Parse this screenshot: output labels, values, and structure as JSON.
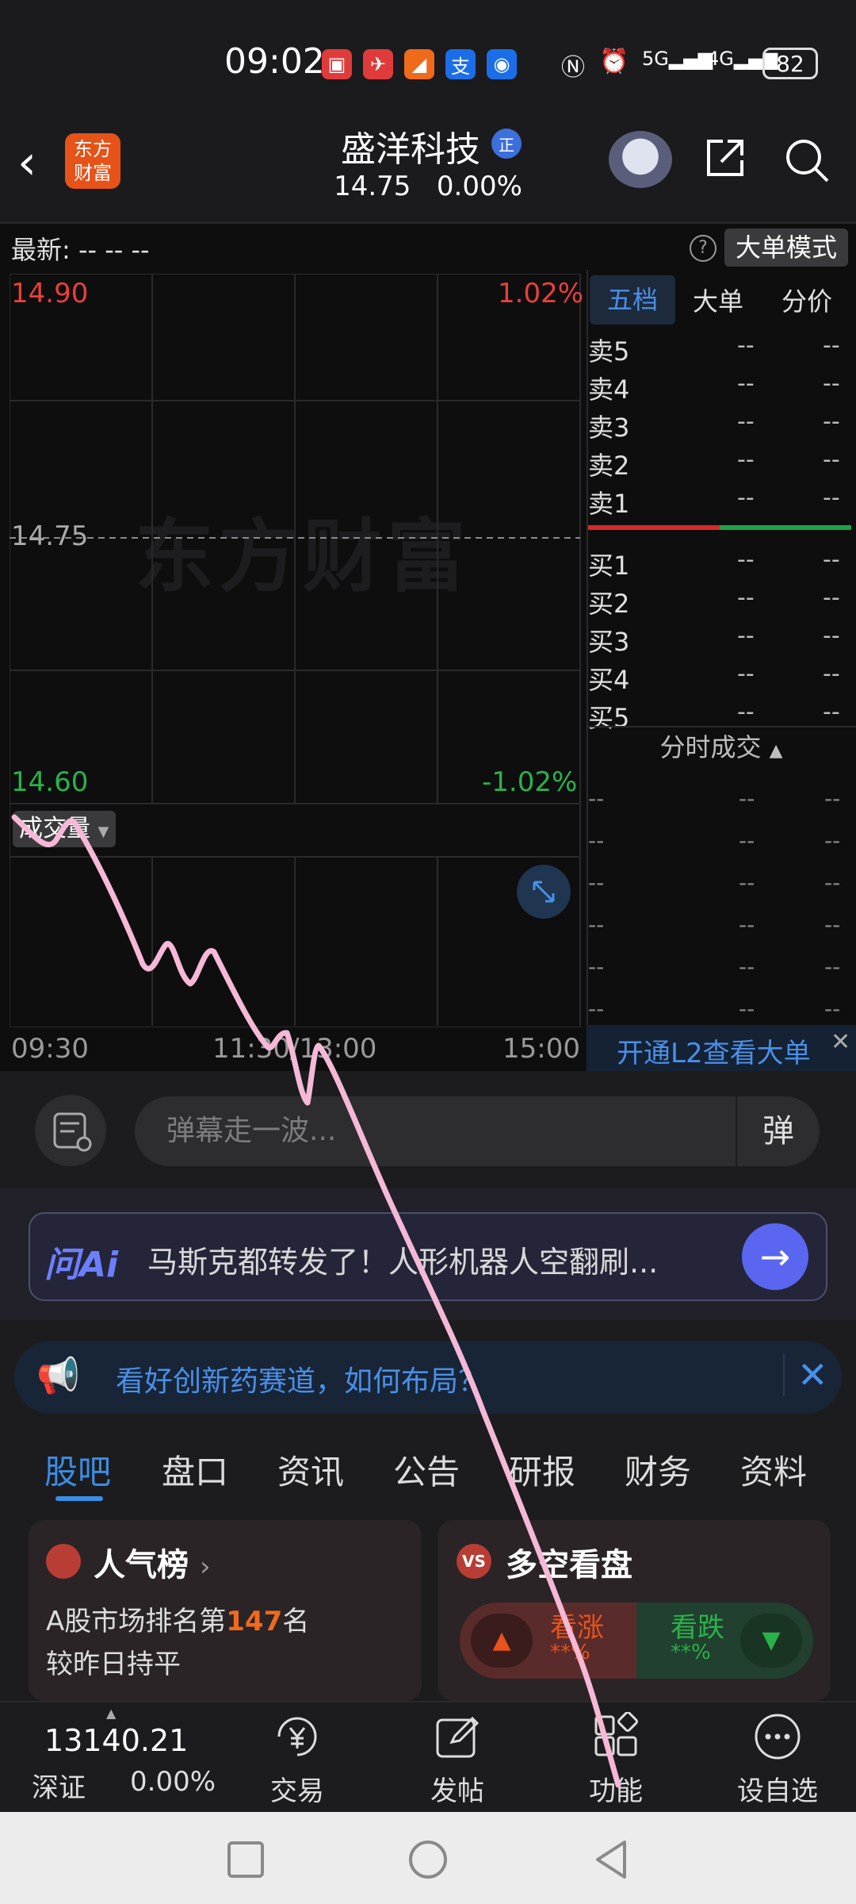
{
  "status_bar": {
    "time": "09:02",
    "battery": "82",
    "network_1": "5G",
    "network_2": "4G"
  },
  "header": {
    "logo_text_1": "东方",
    "logo_text_2": "财富",
    "title": "盛洋科技",
    "title_badge": "正",
    "price": "14.75",
    "change_pct": "0.00%"
  },
  "quote": {
    "latest_label": "最新:",
    "latest_values": "-- -- --",
    "big_order_mode": "大单模式",
    "price_high": "14.90",
    "pct_high": "1.02%",
    "price_mid": "14.75",
    "price_low": "14.60",
    "pct_low": "-1.02%",
    "watermark": "东方财富",
    "volume_selector": "成交量",
    "time_start": "09:30",
    "time_mid": "11:30/13:00",
    "time_end": "15:00"
  },
  "order_book": {
    "tabs": [
      "五档",
      "大单",
      "分价"
    ],
    "sell": [
      {
        "label": "卖5",
        "price": "--",
        "vol": "--"
      },
      {
        "label": "卖4",
        "price": "--",
        "vol": "--"
      },
      {
        "label": "卖3",
        "price": "--",
        "vol": "--"
      },
      {
        "label": "卖2",
        "price": "--",
        "vol": "--"
      },
      {
        "label": "卖1",
        "price": "--",
        "vol": "--"
      }
    ],
    "buy": [
      {
        "label": "买1",
        "price": "--",
        "vol": "--"
      },
      {
        "label": "买2",
        "price": "--",
        "vol": "--"
      },
      {
        "label": "买3",
        "price": "--",
        "vol": "--"
      },
      {
        "label": "买4",
        "price": "--",
        "vol": "--"
      },
      {
        "label": "买5",
        "price": "--",
        "vol": "--"
      }
    ],
    "ticks_header": "分时成交",
    "ticks": [
      {
        "time": "--",
        "price": "--",
        "vol": "--"
      },
      {
        "time": "--",
        "price": "--",
        "vol": "--"
      },
      {
        "time": "--",
        "price": "--",
        "vol": "--"
      },
      {
        "time": "--",
        "price": "--",
        "vol": "--"
      },
      {
        "time": "--",
        "price": "--",
        "vol": "--"
      },
      {
        "time": "--",
        "price": "--",
        "vol": "--"
      }
    ],
    "l2_promo": "开通L2查看大单"
  },
  "danmaku": {
    "placeholder": "弹幕走一波...",
    "button": "弹"
  },
  "ai_bar": {
    "logo": "问Ai",
    "text": "马斯克都转发了！人形机器人空翻刷..."
  },
  "banner": {
    "text": "看好创新药赛道，如何布局？"
  },
  "tabs": [
    "股吧",
    "盘口",
    "资讯",
    "公告",
    "研报",
    "财务",
    "资料"
  ],
  "cards": {
    "popularity": {
      "title": "人气榜",
      "line1_pre": "A股市场排名第",
      "rank": "147",
      "line1_post": "名",
      "line2": "较昨日持平"
    },
    "bull_bear": {
      "icon": "VS",
      "title": "多空看盘",
      "up_label": "看涨",
      "up_pct": "**%",
      "down_label": "看跌",
      "down_pct": "**%"
    }
  },
  "bottom_nav": {
    "index_value": "13140.21",
    "index_name": "深证",
    "index_pct": "0.00%",
    "items": [
      "交易",
      "发帖",
      "功能",
      "设自选"
    ]
  },
  "colors": {
    "up": "#e8403b",
    "down": "#2ab24a",
    "accent": "#4a8fe8",
    "scribble": "#f5b8d6"
  }
}
